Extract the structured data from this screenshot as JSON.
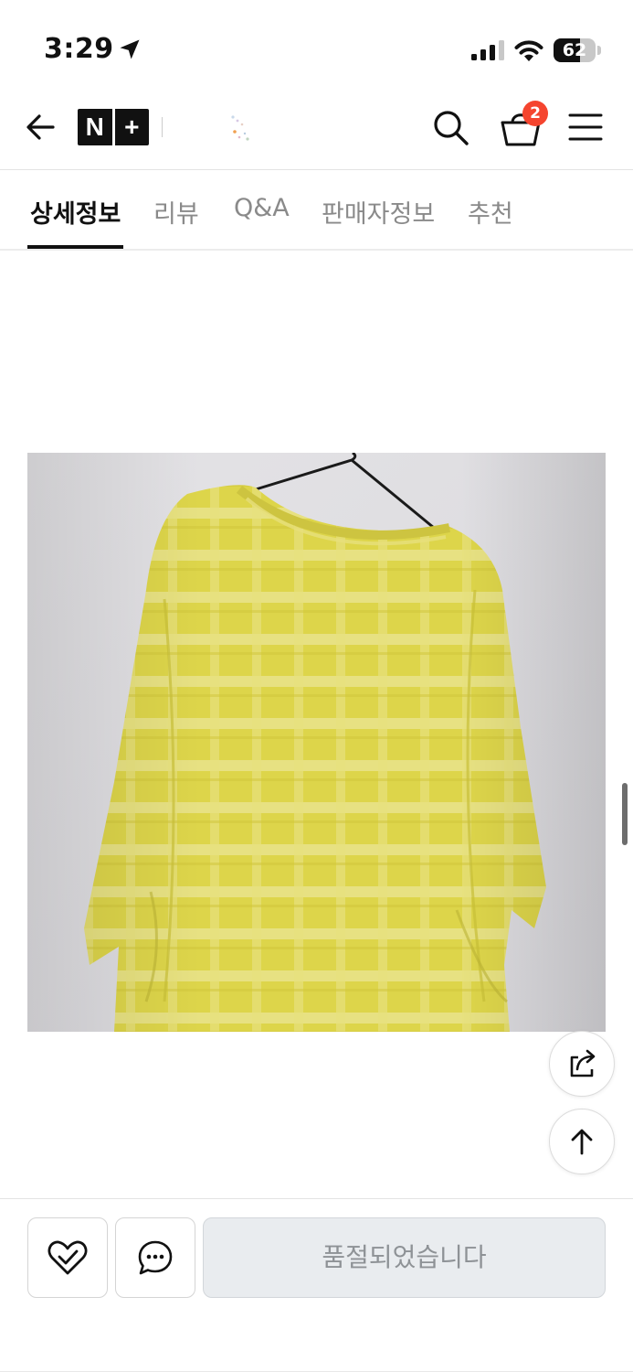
{
  "status_bar": {
    "time": "3:29",
    "battery_level": "62",
    "battery_fraction": 0.62,
    "icons": [
      "location-arrow-icon",
      "signal-icon",
      "wifi-icon",
      "battery-icon"
    ]
  },
  "header": {
    "logo_letters": [
      "N",
      "+"
    ],
    "cart_count": "2",
    "icons": [
      "back-arrow-icon",
      "search-icon",
      "cart-icon",
      "menu-icon"
    ]
  },
  "tabs": [
    {
      "label": "상세정보",
      "active": true
    },
    {
      "label": "리뷰",
      "active": false
    },
    {
      "label": "Q&A",
      "active": false
    },
    {
      "label": "판매자정보",
      "active": false
    },
    {
      "label": "추천",
      "active": false
    }
  ],
  "product": {
    "image": "yellow-plaid-linen-top-photo"
  },
  "floating": {
    "icons": [
      "share-icon",
      "arrow-up-icon"
    ]
  },
  "bottom_bar": {
    "soldout_label": "품절되었습니다",
    "icons": [
      "heart-wish-icon",
      "chat-bubble-icon"
    ]
  },
  "colors": {
    "badge": "#f5452f",
    "garment": "#e0d84a",
    "soldout_bg": "#e9ecef",
    "soldout_text": "#8e9296"
  }
}
